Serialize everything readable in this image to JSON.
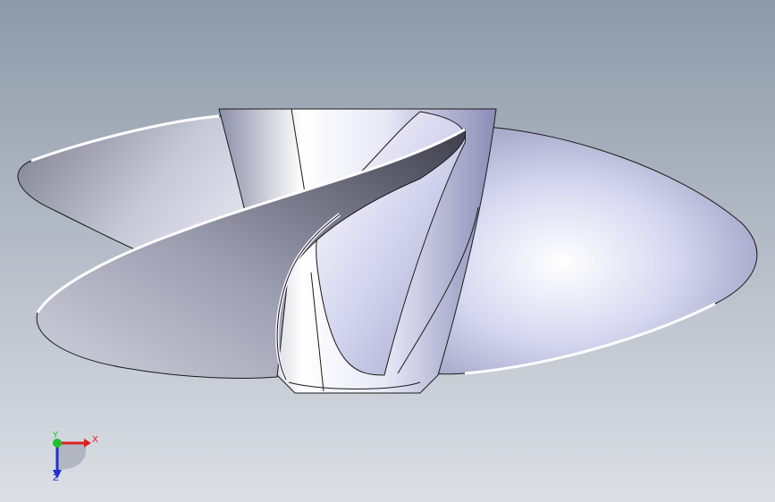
{
  "viewport": {
    "background_top": "#8e9aa9",
    "background_bottom": "#dcdfe5"
  },
  "model": {
    "body_color": "#b9bbd8",
    "highlight_color": "#ffffff",
    "edge_color": "#1a1a1a"
  },
  "triad": {
    "x_label": "X",
    "y_label": "Y",
    "z_label": "Z",
    "x_color": "#e02020",
    "y_color": "#20c030",
    "z_color": "#2030d0"
  }
}
